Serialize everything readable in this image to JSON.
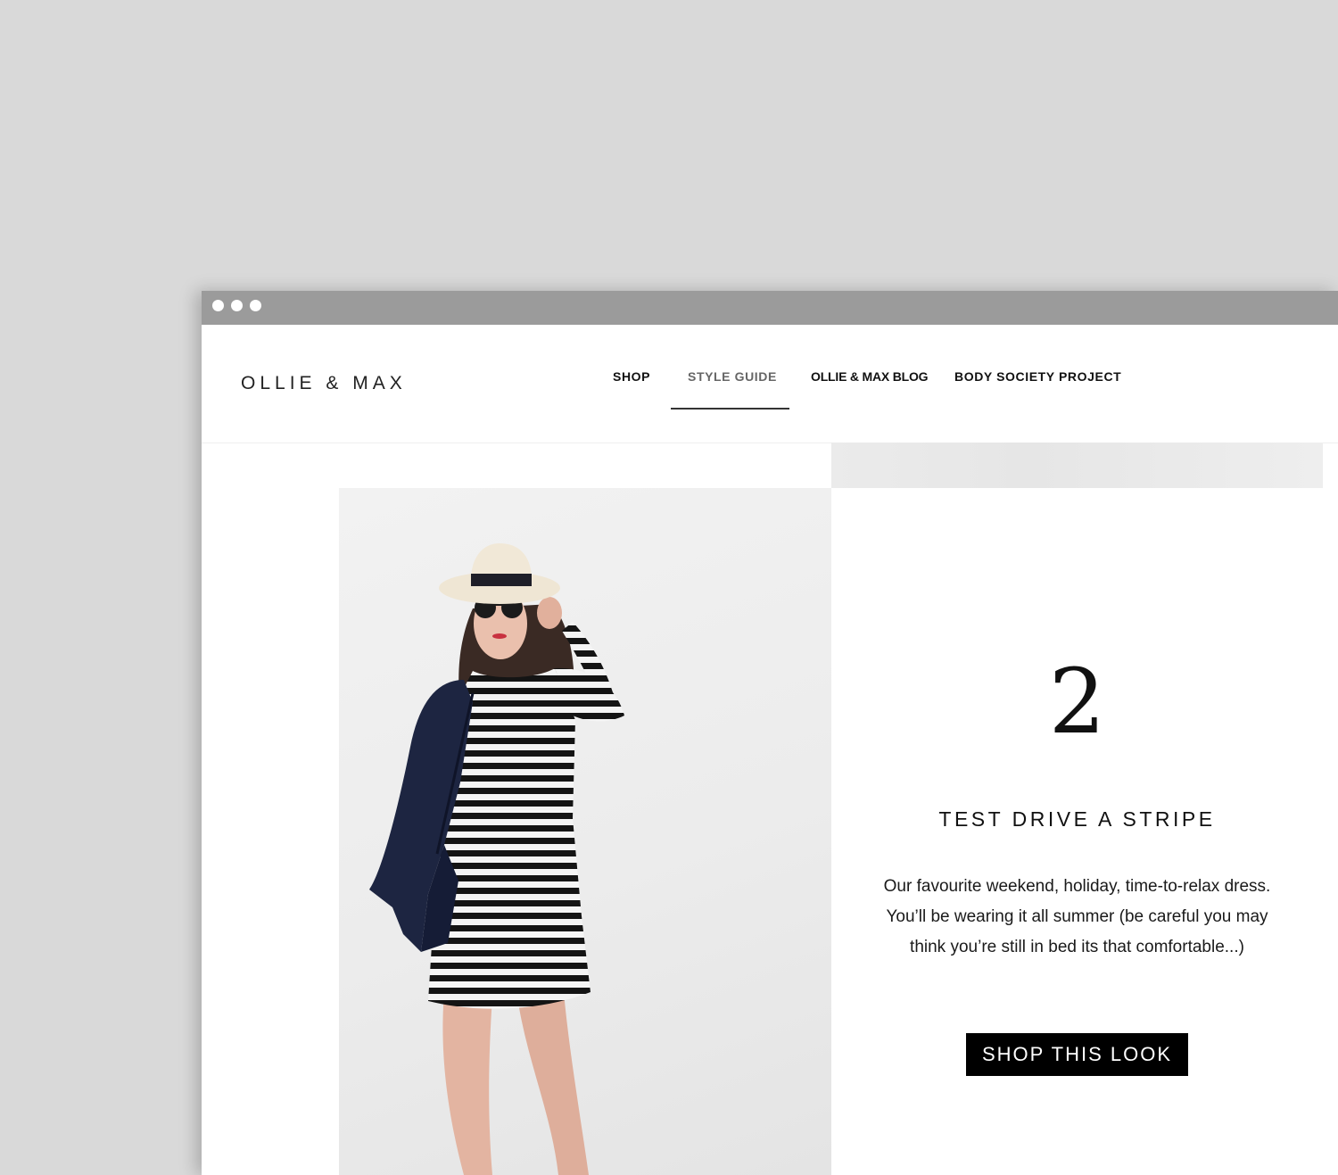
{
  "window": {
    "controls": [
      "dot-icon",
      "dot-icon",
      "dot-icon"
    ]
  },
  "header": {
    "logo": "OLLIE & MAX",
    "nav": {
      "shop": "SHOP",
      "style_guide": "STYLE GUIDE",
      "blog": "OLLIE & MAX BLOG",
      "body_society": "BODY SOCIETY PROJECT"
    },
    "active_nav": "STYLE GUIDE"
  },
  "feature": {
    "number": "2",
    "title": "TEST DRIVE A STRIPE",
    "description": "Our favourite weekend, holiday, time-to-relax dress. You’ll be wearing it all summer (be careful you may think you’re still in bed its that comfortable...)",
    "cta_label": "SHOP THIS LOOK"
  },
  "colors": {
    "page_background": "#d9d9d9",
    "titlebar": "#9b9b9b",
    "cta_background": "#000000",
    "cta_text": "#ffffff"
  }
}
